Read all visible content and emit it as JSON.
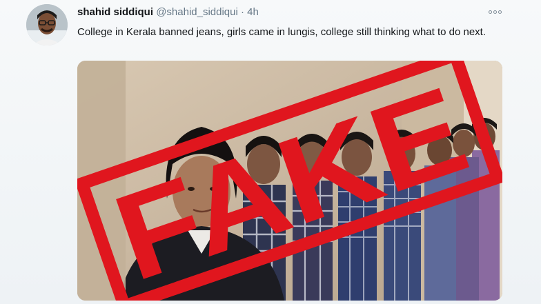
{
  "tweet": {
    "display_name": "shahid siddiqui",
    "handle": "@shahid_siddiqui",
    "separator": "·",
    "time": "4h",
    "text": "College in Kerala banned jeans, girls came in lungis, college still thinking what to do next.",
    "more_icon": "more-options-icon"
  },
  "overlay": {
    "stamp_text": "FAKE",
    "stamp_color": "#e0161e"
  },
  "colors": {
    "name": "#14171a",
    "secondary": "#657786",
    "background": "#f5f8fa"
  }
}
